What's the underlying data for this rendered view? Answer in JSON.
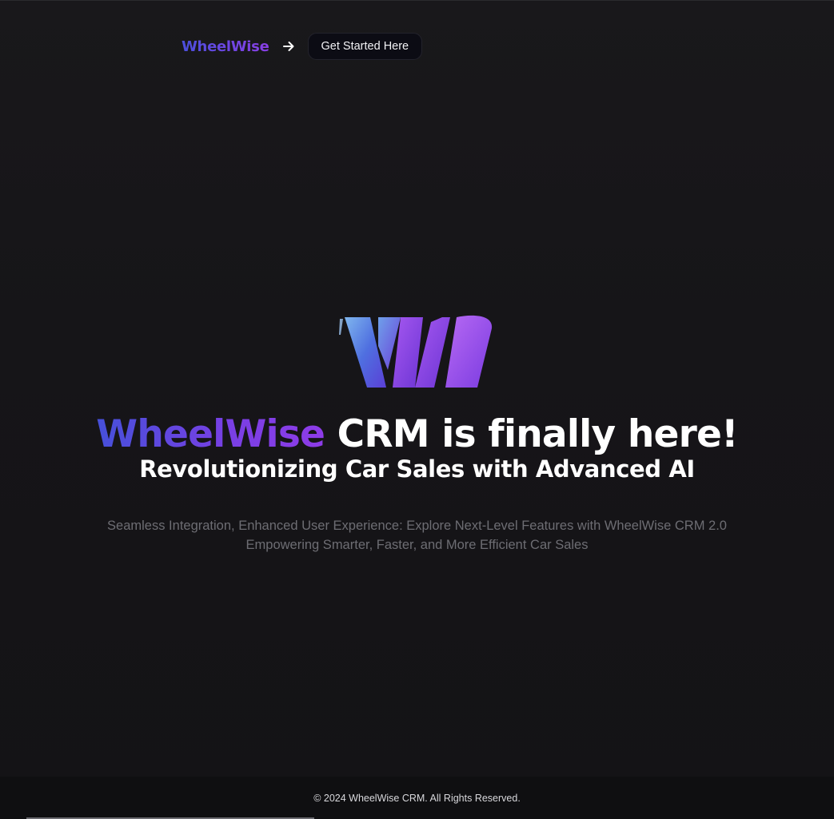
{
  "header": {
    "brand": "WheelWise",
    "cta_label": "Get Started Here",
    "arrow_icon": "arrow-right-icon"
  },
  "hero": {
    "logo_icon": "wheelwise-w-logo-icon",
    "headline_brand": "WheelWise",
    "headline_rest": " CRM is finally here!",
    "subheadline": "Revolutionizing Car Sales with Advanced AI",
    "description_line1": "Seamless Integration, Enhanced User Experience: Explore Next-Level Features with WheelWise CRM 2.0",
    "description_line2": "Empowering Smarter, Faster, and More Efficient Car Sales"
  },
  "footer": {
    "copyright": "© 2024 WheelWise CRM. All Rights Reserved."
  },
  "colors": {
    "background": "#141316",
    "brand_gradient_start": "#4650da",
    "brand_gradient_end": "#8e3ce8",
    "button_bg": "#0c0c14",
    "muted_text": "#6d6d73"
  }
}
